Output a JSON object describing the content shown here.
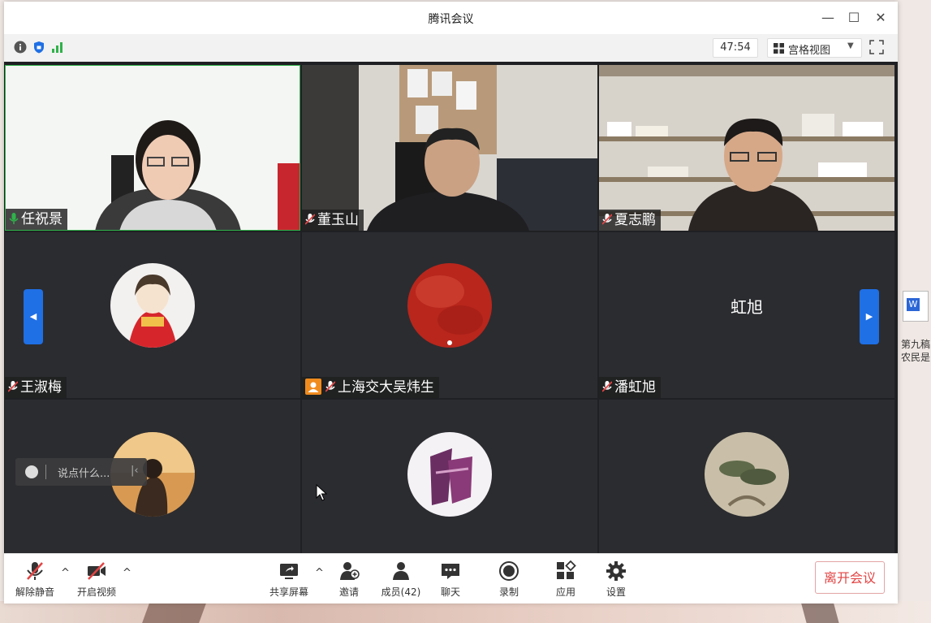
{
  "window": {
    "title": "腾讯会议"
  },
  "infobar": {
    "timer": "47:54",
    "view_mode": "宫格视图"
  },
  "participants": [
    {
      "name": "任祝景",
      "type": "video",
      "mic": "on"
    },
    {
      "name": "董玉山",
      "type": "video",
      "mic": "muted"
    },
    {
      "name": "夏志鹏",
      "type": "video",
      "mic": "muted"
    },
    {
      "name": "王淑梅",
      "type": "avatar",
      "mic": "muted"
    },
    {
      "name": "上海交大吴炜生",
      "type": "avatar",
      "mic": "muted",
      "host_badge": true
    },
    {
      "name": "潘虹旭",
      "type": "text",
      "mic": "muted",
      "display_text": "虹旭"
    },
    {
      "name": "",
      "type": "avatar"
    },
    {
      "name": "",
      "type": "avatar"
    },
    {
      "name": "",
      "type": "avatar"
    }
  ],
  "chat": {
    "placeholder": "说点什么..."
  },
  "toolbar": {
    "unmute": "解除静音",
    "start_video": "开启视频",
    "share_screen": "共享屏幕",
    "invite": "邀请",
    "members": "成员(42)",
    "chat": "聊天",
    "record": "录制",
    "apps": "应用",
    "settings": "设置",
    "leave": "离开会议"
  },
  "desktop": {
    "file_label_1": "第九稿",
    "file_label_2": "农民是"
  },
  "colors": {
    "accent": "#1f6fe5",
    "leave": "#e24444",
    "mic_on": "#2fb24a",
    "stage": "#2b2c30"
  }
}
